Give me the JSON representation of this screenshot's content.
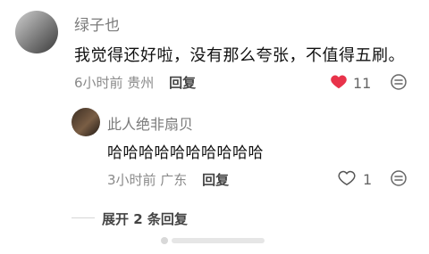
{
  "comment": {
    "username": "绿子也",
    "text": "我觉得还好啦，没有那么夸张，不值得五刷。",
    "meta": "6小时前 贵州",
    "reply_label": "回复",
    "likes": "11",
    "liked": true
  },
  "reply": {
    "username": "此人绝非扇贝",
    "text": "哈哈哈哈哈哈哈哈哈哈",
    "meta": "3小时前 广东",
    "reply_label": "回复",
    "likes": "1",
    "liked": false
  },
  "expand": {
    "label": "展开 2 条回复"
  },
  "colors": {
    "like_red": "#e8334a",
    "text_primary": "#111111",
    "text_secondary": "#8a8a8a"
  }
}
